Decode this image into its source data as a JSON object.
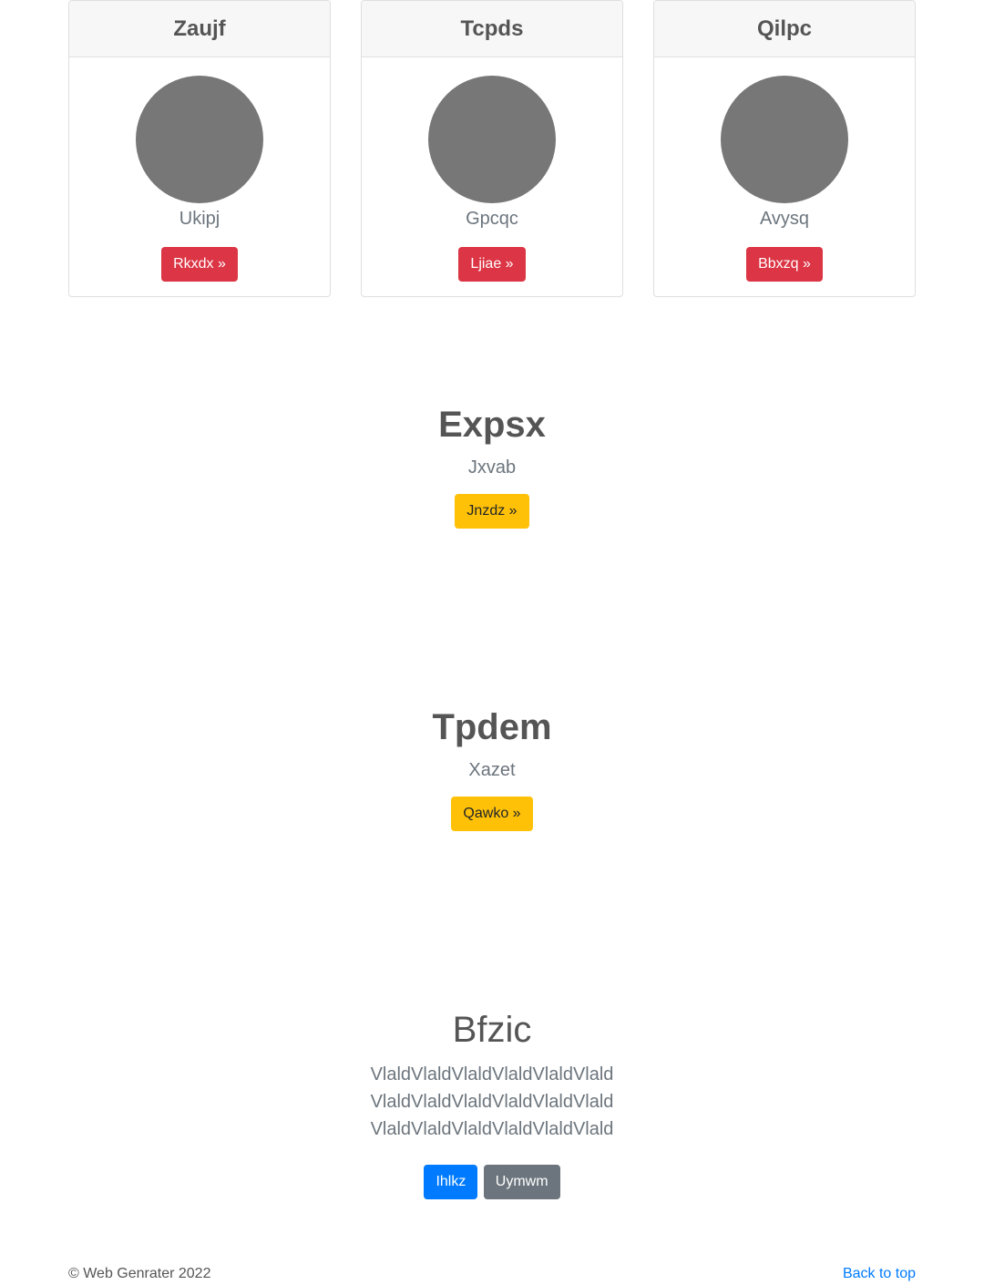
{
  "cards": [
    {
      "title": "Zaujf",
      "subtitle": "Ukipj",
      "button_label": "Rkxdx »"
    },
    {
      "title": "Tcpds",
      "subtitle": "Gpcqc",
      "button_label": "Ljiae »"
    },
    {
      "title": "Qilpc",
      "subtitle": "Avysq",
      "button_label": "Bbxzq »"
    }
  ],
  "feature1": {
    "title": "Expsx",
    "subtitle": "Jxvab",
    "button_label": "Jnzdz »"
  },
  "feature2": {
    "title": "Tpdem",
    "subtitle": "Xazet",
    "button_label": "Qawko »"
  },
  "hero": {
    "title": "Bfzic",
    "lead": "VlaldVlaldVlaldVlaldVlaldVlald VlaldVlaldVlaldVlaldVlaldVlald VlaldVlaldVlaldVlaldVlaldVlald",
    "primary_button": "Ihlkz",
    "secondary_button": "Uymwm"
  },
  "footer": {
    "copyright": "© Web Genrater 2022",
    "back_to_top": "Back to top"
  },
  "colors": {
    "danger": "#dc3545",
    "warning": "#ffc107",
    "primary": "#007bff",
    "secondary": "#6c757d",
    "avatar_placeholder": "#777777"
  }
}
